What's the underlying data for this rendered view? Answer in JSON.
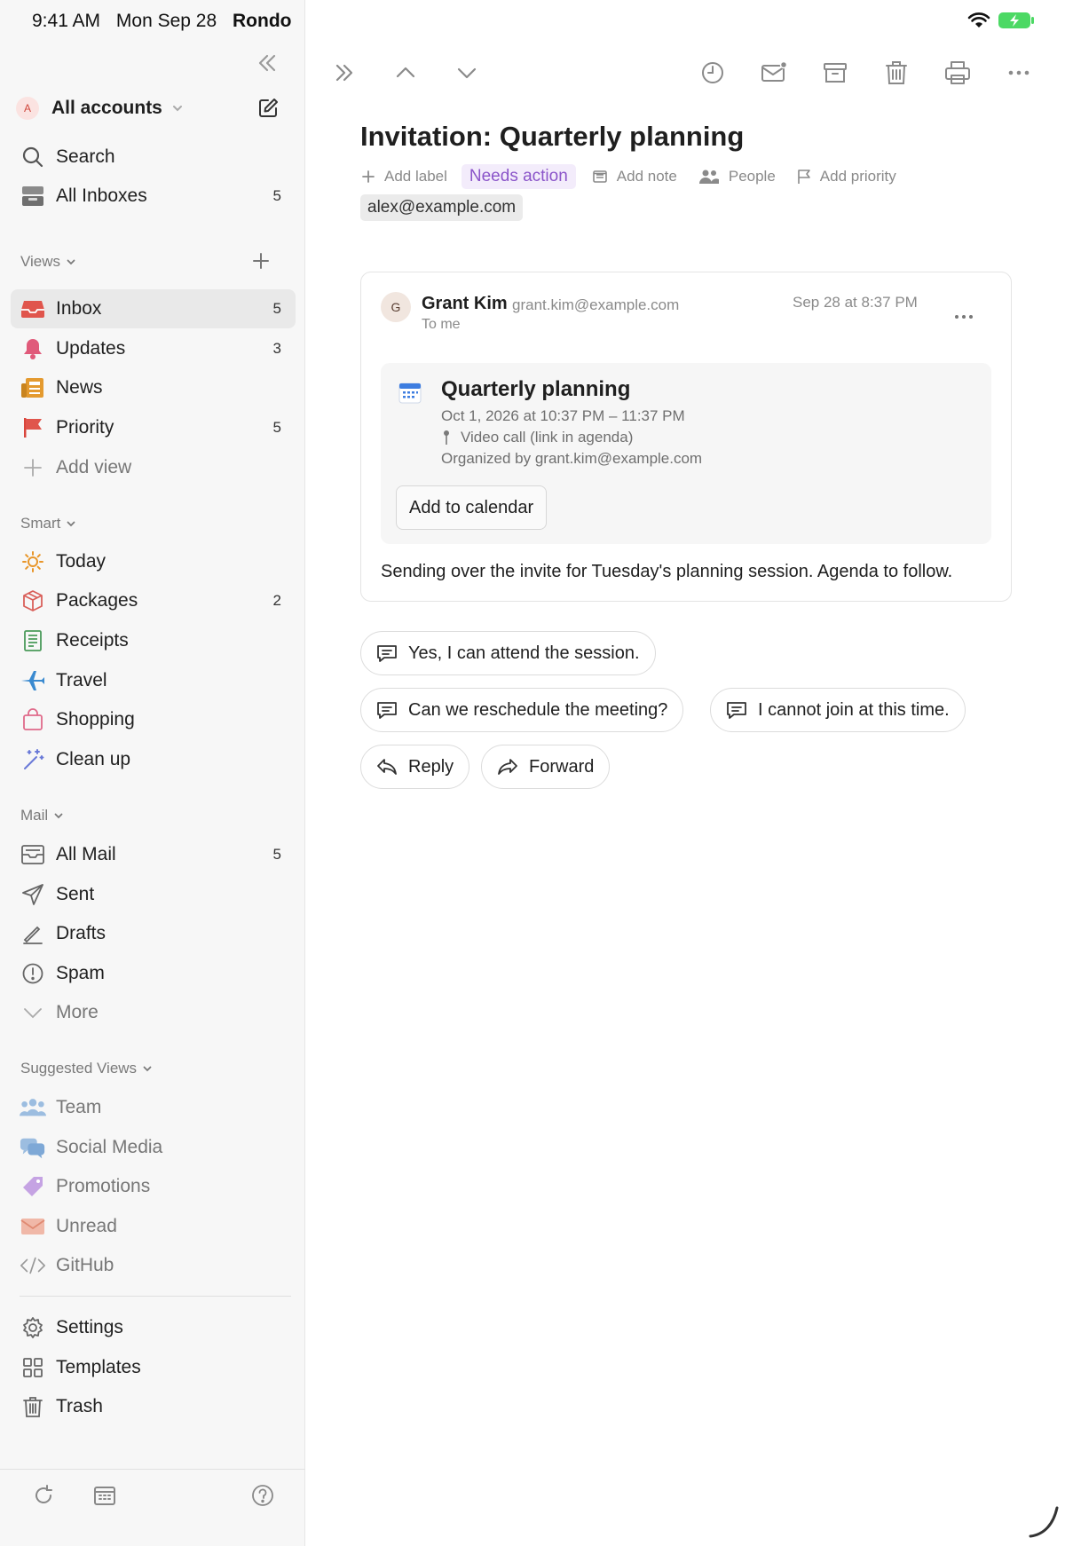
{
  "status_bar": {
    "time": "9:41 AM",
    "date": "Mon Sep 28",
    "carrier": "Rondo"
  },
  "sidebar": {
    "account": {
      "avatar_letter": "A",
      "label": "All accounts"
    },
    "top_items": [
      {
        "label": "Search",
        "icon": "search-icon"
      },
      {
        "label": "All Inboxes",
        "count": "5",
        "icon": "inboxes-icon"
      }
    ],
    "views": {
      "header": "Views",
      "items": [
        {
          "label": "Inbox",
          "count": "5",
          "icon": "inbox-icon"
        },
        {
          "label": "Updates",
          "count": "3",
          "icon": "bell-icon"
        },
        {
          "label": "News",
          "icon": "newspaper-icon"
        },
        {
          "label": "Priority",
          "count": "5",
          "icon": "flag-icon"
        },
        {
          "label": "Add view",
          "icon": "plus-icon"
        }
      ]
    },
    "smart": {
      "header": "Smart",
      "items": [
        {
          "label": "Today",
          "icon": "sun-icon"
        },
        {
          "label": "Packages",
          "count": "2",
          "icon": "package-icon"
        },
        {
          "label": "Receipts",
          "icon": "receipt-icon"
        },
        {
          "label": "Travel",
          "icon": "airplane-icon"
        },
        {
          "label": "Shopping",
          "icon": "shopping-bag-icon"
        },
        {
          "label": "Clean up",
          "icon": "magic-wand-icon"
        }
      ]
    },
    "mail": {
      "header": "Mail",
      "items": [
        {
          "label": "All Mail",
          "count": "5",
          "icon": "archive-tray-icon"
        },
        {
          "label": "Sent",
          "icon": "paper-plane-icon"
        },
        {
          "label": "Drafts",
          "icon": "pencil-icon"
        },
        {
          "label": "Spam",
          "icon": "alert-circle-icon"
        },
        {
          "label": "More",
          "icon": "chevron-down-icon"
        }
      ]
    },
    "suggested": {
      "header": "Suggested Views",
      "items": [
        {
          "label": "Team",
          "icon": "people-icon"
        },
        {
          "label": "Social Media",
          "icon": "chat-bubbles-icon"
        },
        {
          "label": "Promotions",
          "icon": "tag-icon"
        },
        {
          "label": "Unread",
          "icon": "envelope-icon"
        },
        {
          "label": "GitHub",
          "icon": "code-icon"
        }
      ]
    },
    "bottom_items": [
      {
        "label": "Settings",
        "icon": "gear-icon"
      },
      {
        "label": "Templates",
        "icon": "grid-icon"
      },
      {
        "label": "Trash",
        "icon": "trash-icon"
      }
    ]
  },
  "email": {
    "subject": "Invitation: Quarterly planning",
    "meta": {
      "add_label": "Add label",
      "status_badge": "Needs action",
      "add_note": "Add note",
      "people": "People",
      "add_priority": "Add priority",
      "recipient_chip": "alex@example.com"
    },
    "message": {
      "avatar_letter": "G",
      "sender_name": "Grant Kim",
      "sender_email": "grant.kim@example.com",
      "to": "To me",
      "date": "Sep 28 at 8:37 PM",
      "invite": {
        "title": "Quarterly planning",
        "when": "Oct 1, 2026 at 10:37 PM – 11:37 PM",
        "location": "Video call (link in agenda)",
        "organizer": "Organized by grant.kim@example.com",
        "add_button": "Add to calendar"
      },
      "body": "Sending over the invite for Tuesday's planning session. Agenda to follow."
    },
    "quick_replies": [
      "Yes, I can attend the session.",
      "Can we reschedule the meeting?",
      "I cannot join at this time."
    ],
    "actions": {
      "reply": "Reply",
      "forward": "Forward"
    }
  },
  "colors": {
    "badge_purple": "#8b55c9",
    "battery_green": "#4cd964",
    "accent_red": "#e0554c"
  }
}
